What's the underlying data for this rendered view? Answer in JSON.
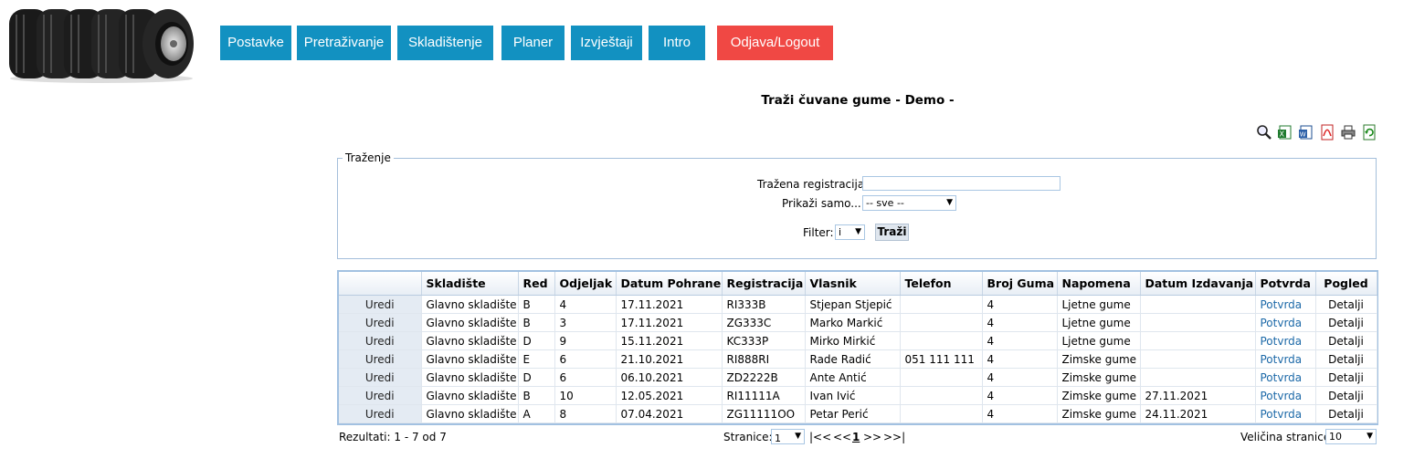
{
  "nav": {
    "items": [
      {
        "label": "Postavke"
      },
      {
        "label": "Pretraživanje"
      },
      {
        "label": "Skladištenje"
      },
      {
        "label": "Planer"
      },
      {
        "label": "Izvještaji"
      },
      {
        "label": "Intro"
      },
      {
        "label": "Odjava/Logout"
      }
    ]
  },
  "page": {
    "title": "Traži čuvane gume - Demo -"
  },
  "toolbar": {
    "icons": [
      "search-icon",
      "excel-export-icon",
      "word-export-icon",
      "pdf-export-icon",
      "print-icon",
      "refresh-icon"
    ]
  },
  "search": {
    "legend": "Traženje",
    "registration_label": "Tražena registracija",
    "registration_value": "",
    "show_only_label": "Prikaži samo...",
    "show_only_value": "-- sve --",
    "filter_label": "Filter:",
    "filter_value": "i",
    "submit_label": "Traži"
  },
  "grid": {
    "columns": [
      "",
      "Skladište",
      "Red",
      "Odjeljak",
      "Datum Pohrane",
      "Registracija",
      "Vlasnik",
      "Telefon",
      "Broj Guma",
      "Napomena",
      "Datum Izdavanja",
      "Potvrda",
      "Pogled"
    ],
    "rows": [
      {
        "edit": "Uredi",
        "skladiste": "Glavno skladište",
        "red": "B",
        "odjeljak": "4",
        "datum_pohrane": "17.11.2021",
        "registracija": "RI333B",
        "vlasnik": "Stjepan Stjepić",
        "telefon": "",
        "broj_guma": "4",
        "napomena": "Ljetne gume",
        "datum_izdavanja": "",
        "potvrda": "Potvrda",
        "pogled": "Detalji"
      },
      {
        "edit": "Uredi",
        "skladiste": "Glavno skladište",
        "red": "B",
        "odjeljak": "3",
        "datum_pohrane": "17.11.2021",
        "registracija": "ZG333C",
        "vlasnik": "Marko Markić",
        "telefon": "",
        "broj_guma": "4",
        "napomena": "Ljetne gume",
        "datum_izdavanja": "",
        "potvrda": "Potvrda",
        "pogled": "Detalji"
      },
      {
        "edit": "Uredi",
        "skladiste": "Glavno skladište",
        "red": "D",
        "odjeljak": "9",
        "datum_pohrane": "15.11.2021",
        "registracija": "KC333P",
        "vlasnik": "Mirko Mirkić",
        "telefon": "",
        "broj_guma": "4",
        "napomena": "Ljetne gume",
        "datum_izdavanja": "",
        "potvrda": "Potvrda",
        "pogled": "Detalji"
      },
      {
        "edit": "Uredi",
        "skladiste": "Glavno skladište",
        "red": "E",
        "odjeljak": "6",
        "datum_pohrane": "21.10.2021",
        "registracija": "RI888RI",
        "vlasnik": "Rade Radić",
        "telefon": "051 111 111",
        "broj_guma": "4",
        "napomena": "Zimske gume",
        "datum_izdavanja": "",
        "potvrda": "Potvrda",
        "pogled": "Detalji"
      },
      {
        "edit": "Uredi",
        "skladiste": "Glavno skladište",
        "red": "D",
        "odjeljak": "6",
        "datum_pohrane": "06.10.2021",
        "registracija": "ZD2222B",
        "vlasnik": "Ante Antić",
        "telefon": "",
        "broj_guma": "4",
        "napomena": "Zimske gume",
        "datum_izdavanja": "",
        "potvrda": "Potvrda",
        "pogled": "Detalji"
      },
      {
        "edit": "Uredi",
        "skladiste": "Glavno skladište",
        "red": "B",
        "odjeljak": "10",
        "datum_pohrane": "12.05.2021",
        "registracija": "RI11111A",
        "vlasnik": "Ivan Ivić",
        "telefon": "",
        "broj_guma": "4",
        "napomena": "Zimske gume",
        "datum_izdavanja": "27.11.2021",
        "potvrda": "Potvrda",
        "pogled": "Detalji"
      },
      {
        "edit": "Uredi",
        "skladiste": "Glavno skladište",
        "red": "A",
        "odjeljak": "8",
        "datum_pohrane": "07.04.2021",
        "registracija": "ZG11111OO",
        "vlasnik": "Petar Perić",
        "telefon": "",
        "broj_guma": "4",
        "napomena": "Zimske gume",
        "datum_izdavanja": "24.11.2021",
        "potvrda": "Potvrda",
        "pogled": "Detalji"
      }
    ]
  },
  "footer": {
    "results": "Rezultati: 1 - 7 od 7",
    "pages_label": "Stranice:",
    "page_value": "1",
    "pager_first": "|<<",
    "pager_prev": "<<",
    "pager_current": "1",
    "pager_next": ">>",
    "pager_last": ">>|",
    "page_size_label": "Veličina stranice:",
    "page_size_value": "10"
  }
}
